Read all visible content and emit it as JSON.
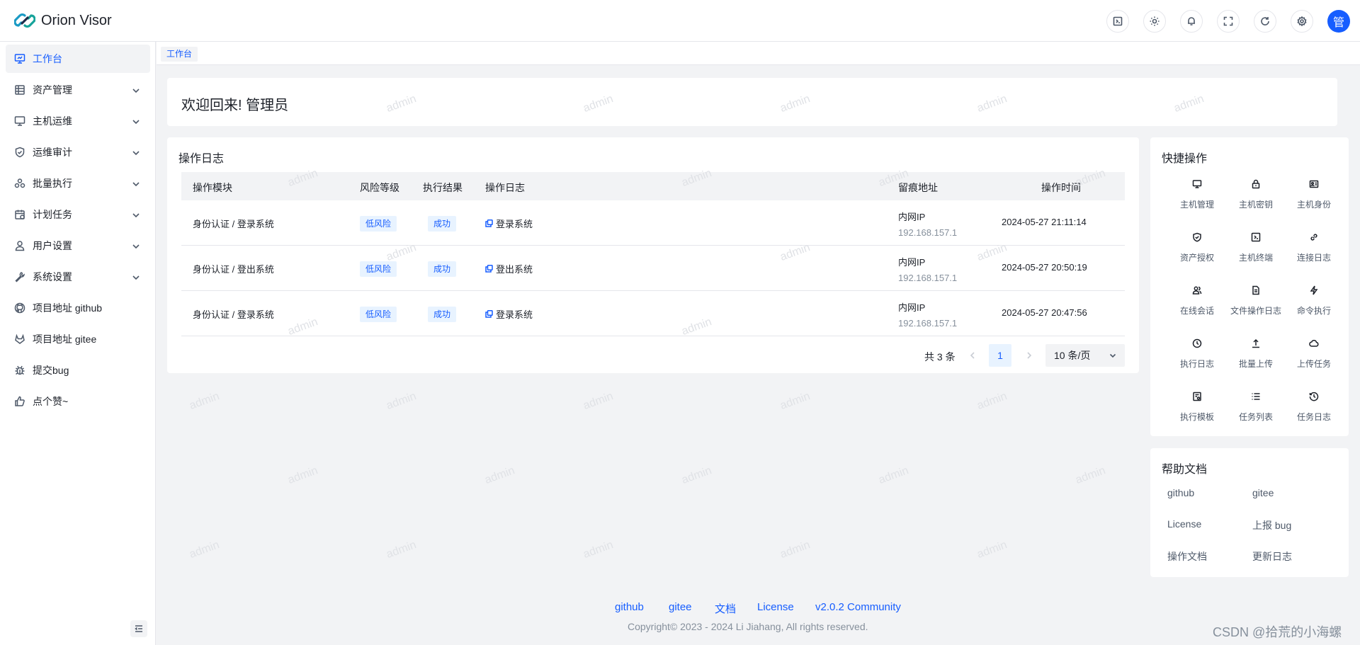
{
  "app": {
    "title": "Orion Visor",
    "avatar_text": "管"
  },
  "header": {
    "tools": [
      "terminal-icon",
      "theme-icon",
      "bell-icon",
      "fullscreen-icon",
      "refresh-icon",
      "settings-icon"
    ]
  },
  "sidebar": {
    "items": [
      {
        "label": "工作台",
        "icon": "dashboard-icon"
      },
      {
        "label": "资产管理",
        "icon": "asset-icon"
      },
      {
        "label": "主机运维",
        "icon": "monitor-icon"
      },
      {
        "label": "运维审计",
        "icon": "shield-icon"
      },
      {
        "label": "批量执行",
        "icon": "batch-icon"
      },
      {
        "label": "计划任务",
        "icon": "schedule-icon"
      },
      {
        "label": "用户设置",
        "icon": "user-icon"
      },
      {
        "label": "系统设置",
        "icon": "wrench-icon"
      },
      {
        "label": "项目地址 github",
        "icon": "github-icon"
      },
      {
        "label": "项目地址 gitee",
        "icon": "gitee-icon"
      },
      {
        "label": "提交bug",
        "icon": "bug-icon"
      },
      {
        "label": "点个赞~",
        "icon": "thumb-up-icon"
      }
    ]
  },
  "tabs": {
    "active": "工作台"
  },
  "welcome": {
    "text": "欢迎回来! 管理员"
  },
  "oplog": {
    "title": "操作日志",
    "columns": [
      "操作模块",
      "风险等级",
      "执行结果",
      "操作日志",
      "留痕地址",
      "操作时间"
    ],
    "rows": [
      {
        "module": "身份认证 / 登录系统",
        "risk": "低风险",
        "result": "成功",
        "log": "登录系统",
        "ip_label": "内网IP",
        "ip": "192.168.157.1",
        "time": "2024-05-27 21:11:14"
      },
      {
        "module": "身份认证 / 登出系统",
        "risk": "低风险",
        "result": "成功",
        "log": "登出系统",
        "ip_label": "内网IP",
        "ip": "192.168.157.1",
        "time": "2024-05-27 20:50:19"
      },
      {
        "module": "身份认证 / 登录系统",
        "risk": "低风险",
        "result": "成功",
        "log": "登录系统",
        "ip_label": "内网IP",
        "ip": "192.168.157.1",
        "time": "2024-05-27 20:47:56"
      }
    ],
    "pagination": {
      "total": "共 3 条",
      "current": "1",
      "page_size": "10 条/页"
    }
  },
  "quick": {
    "title": "快捷操作",
    "items": [
      {
        "label": "主机管理",
        "icon": "desktop-icon"
      },
      {
        "label": "主机密钥",
        "icon": "lock-icon"
      },
      {
        "label": "主机身份",
        "icon": "id-card-icon"
      },
      {
        "label": "资产授权",
        "icon": "shield-check-icon"
      },
      {
        "label": "主机终端",
        "icon": "terminal-icon"
      },
      {
        "label": "连接日志",
        "icon": "link-icon"
      },
      {
        "label": "在线会话",
        "icon": "users-icon"
      },
      {
        "label": "文件操作日志",
        "icon": "file-icon"
      },
      {
        "label": "命令执行",
        "icon": "thunder-icon"
      },
      {
        "label": "执行日志",
        "icon": "clock-icon"
      },
      {
        "label": "批量上传",
        "icon": "upload-icon"
      },
      {
        "label": "上传任务",
        "icon": "cloud-icon"
      },
      {
        "label": "执行模板",
        "icon": "template-icon"
      },
      {
        "label": "任务列表",
        "icon": "list-icon"
      },
      {
        "label": "任务日志",
        "icon": "history-icon"
      }
    ]
  },
  "help": {
    "title": "帮助文档",
    "links": [
      "github",
      "gitee",
      "License",
      "上报 bug",
      "操作文档",
      "更新日志"
    ]
  },
  "footer": {
    "links": [
      "github",
      "gitee",
      "文档",
      "License",
      "v2.0.2 Community"
    ],
    "copyright": "Copyright© 2023 - 2024 Li Jiahang, All rights reserved."
  },
  "watermark": {
    "text": "admin"
  },
  "csdn_mark": "CSDN @拾荒的小海螺"
}
